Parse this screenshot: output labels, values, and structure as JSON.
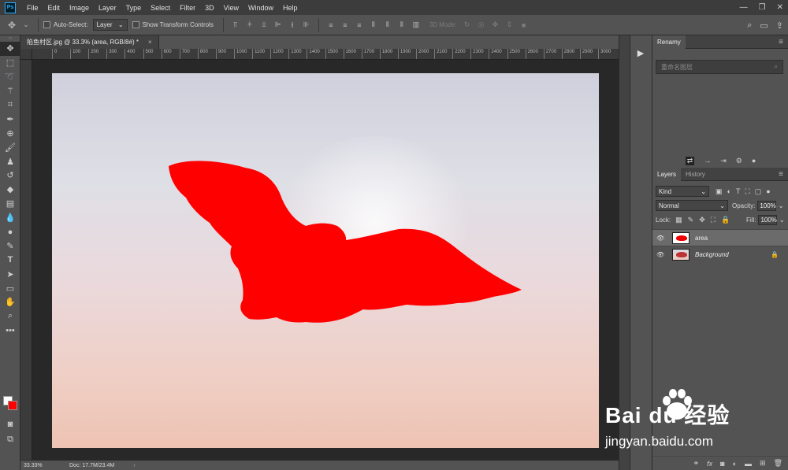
{
  "app": {
    "logo": "Ps"
  },
  "menu": [
    "File",
    "Edit",
    "Image",
    "Layer",
    "Type",
    "Select",
    "Filter",
    "3D",
    "View",
    "Window",
    "Help"
  ],
  "options": {
    "auto_select_label": "Auto-Select:",
    "auto_select_target": "Layer",
    "show_transform_label": "Show Transform Controls",
    "mode_3d_label": "3D Mode:"
  },
  "document": {
    "tab_title": "陷鱼村区.jpg @ 33.3% (area, RGB/8#) *",
    "ruler_ticks": [
      "0",
      "100",
      "200",
      "300",
      "400",
      "500",
      "600",
      "700",
      "800",
      "900",
      "1000",
      "1100",
      "1200",
      "1300",
      "1400",
      "1500",
      "1600",
      "1700",
      "1800",
      "1900",
      "2000",
      "2100",
      "2200",
      "2300",
      "2400",
      "2500",
      "2600",
      "2700",
      "2800",
      "2900",
      "3000"
    ],
    "selection_color": "#ff0000"
  },
  "status": {
    "zoom": "33.33%",
    "doc": "Doc: 17.7M/23.4M"
  },
  "renamy": {
    "title": "Renamy",
    "search_placeholder": "重命名图层"
  },
  "layers_panel": {
    "tabs": [
      "Layers",
      "History"
    ],
    "kind_filter": "Kind",
    "blend_mode": "Normal",
    "opacity_label": "Opacity:",
    "opacity": "100%",
    "lock_label": "Lock:",
    "fill_label": "Fill:",
    "fill": "100%",
    "layers": [
      {
        "name": "area",
        "selected": true
      },
      {
        "name": "Background",
        "locked": true
      }
    ]
  },
  "watermark": {
    "brand": "Bai du 经验",
    "url": "jingyan.baidu.com"
  }
}
